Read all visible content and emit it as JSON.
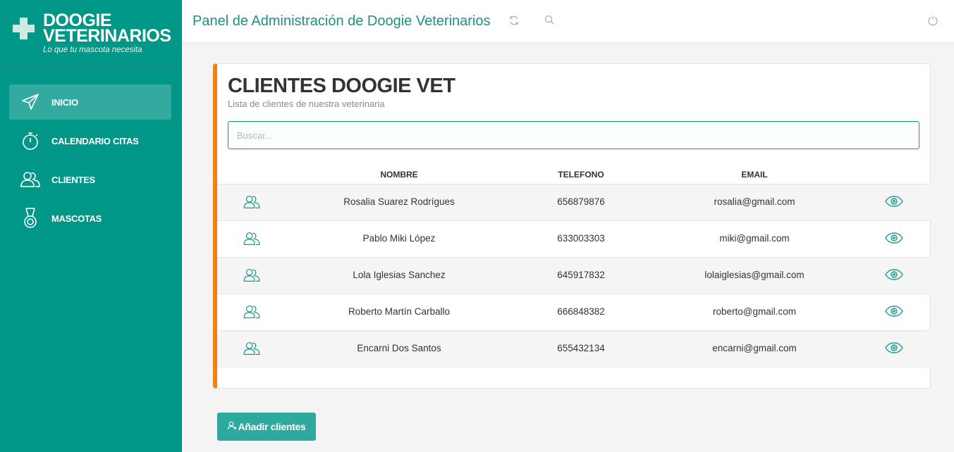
{
  "brand": {
    "name_line1": "DOOGIE",
    "name_line2": "VETERINARIOS",
    "tagline": "Lo que tu mascota necesita"
  },
  "sidebar": {
    "items": [
      {
        "label": "INICIO",
        "icon": "paper-plane-icon",
        "active": true
      },
      {
        "label": "CALENDARIO CITAS",
        "icon": "stopwatch-icon",
        "active": false
      },
      {
        "label": "CLIENTES",
        "icon": "users-icon",
        "active": false
      },
      {
        "label": "MASCOTAS",
        "icon": "medal-icon",
        "active": false
      }
    ]
  },
  "topbar": {
    "title": "Panel de Administración de Doogie Veterinarios",
    "icons": [
      "refresh-icon",
      "search-icon",
      "power-icon"
    ]
  },
  "card": {
    "title": "CLIENTES DOOGIE VET",
    "subtitle": "Lista de clientes de nuestra veterinaria",
    "search_placeholder": "Buscar...",
    "columns": [
      "NOMBRE",
      "TELEFONO",
      "EMAIL"
    ],
    "rows": [
      {
        "name": "Rosalia Suarez Rodrígues",
        "phone": "656879876",
        "email": "rosalia@gmail.com"
      },
      {
        "name": "Pablo Miki López",
        "phone": "633003303",
        "email": "miki@gmail.com"
      },
      {
        "name": "Lola Iglesias Sanchez",
        "phone": "645917832",
        "email": "lolaiglesias@gmail.com"
      },
      {
        "name": "Roberto Martín Carballo",
        "phone": "666848382",
        "email": "roberto@gmail.com"
      },
      {
        "name": "Encarni Dos Santos",
        "phone": "655432134",
        "email": "encarni@gmail.com"
      }
    ]
  },
  "actions": {
    "add_label": "Añadir clientes"
  },
  "colors": {
    "sidebar": "#009688",
    "accent": "#f47f13",
    "button": "#2ea99d",
    "title": "#1f8f84"
  }
}
